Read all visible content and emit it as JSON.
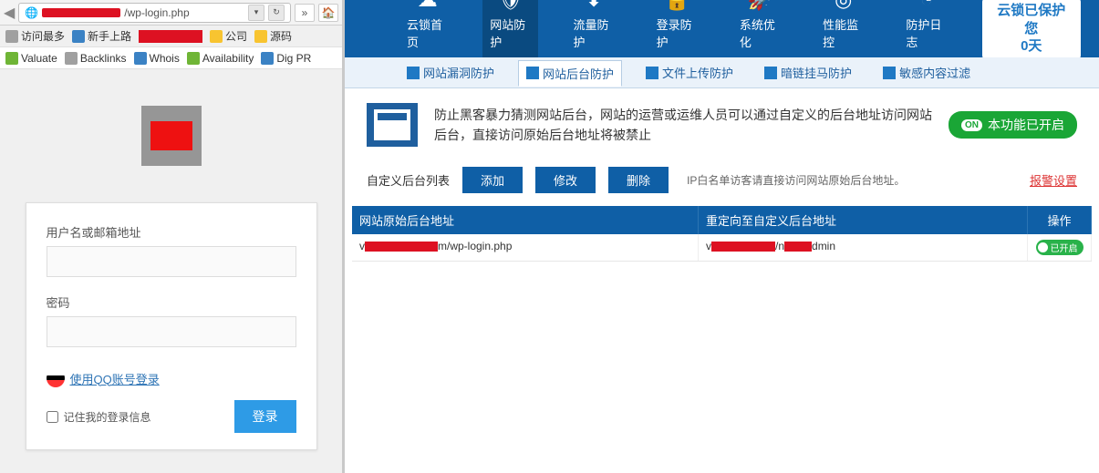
{
  "browser": {
    "url_suffix": "/wp-login.php",
    "bookmarks": {
      "most": "访问最多",
      "newbie": "新手上路",
      "company": "公司",
      "source": "源码"
    },
    "tools": {
      "valuate": "Valuate",
      "backlinks": "Backlinks",
      "whois": "Whois",
      "availability": "Availability",
      "digpr": "Dig PR"
    }
  },
  "login": {
    "user_label": "用户名或邮箱地址",
    "pass_label": "密码",
    "qq_login": "使用QQ账号登录",
    "remember": "记住我的登录信息",
    "submit": "登录"
  },
  "nav": {
    "home": "云锁首页",
    "web": "网站防护",
    "traffic": "流量防护",
    "login": "登录防护",
    "opt": "系统优化",
    "perf": "性能监控",
    "log": "防护日志"
  },
  "protect": {
    "line1": "云锁已保护您",
    "line2": "0天"
  },
  "subtabs": {
    "vuln": "网站漏洞防护",
    "admin": "网站后台防护",
    "upload": "文件上传防护",
    "dark": "暗链挂马防护",
    "sens": "敏感内容过滤"
  },
  "desc": "防止黑客暴力猜测网站后台，网站的运营或运维人员可以通过自定义的后台地址访问网站后台，直接访问原始后台地址将被禁止",
  "enabled": "本功能已开启",
  "on": "ON",
  "actions": {
    "list": "自定义后台列表",
    "add": "添加",
    "edit": "修改",
    "del": "删除",
    "whitelist": "IP白名单访客请直接访问网站原始后台地址。",
    "alarm": "报警设置"
  },
  "table": {
    "h1": "网站原始后台地址",
    "h2": "重定向至自定义后台地址",
    "h3": "操作",
    "rows": [
      {
        "orig_suffix": "m/wp-login.php",
        "redir_suffix": "dmin",
        "on": "已开启"
      }
    ]
  }
}
